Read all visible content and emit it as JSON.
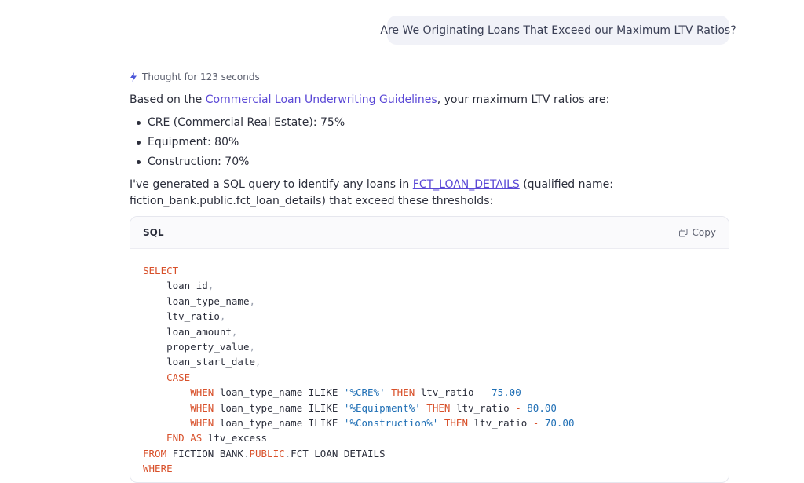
{
  "user_message": "Are We Originating Loans That Exceed our Maximum LTV Ratios?",
  "assistant": {
    "thought_label": "Thought for 123 seconds",
    "intro_prefix": "Based on the ",
    "intro_link": "Commercial Loan Underwriting Guidelines",
    "intro_suffix": ", your maximum LTV ratios are:",
    "bullets": [
      "CRE (Commercial Real Estate): 75%",
      "Equipment: 80%",
      "Construction: 70%"
    ],
    "query_line1_prefix": "I've generated a SQL query to identify any loans in ",
    "query_link": "FCT_LOAN_DETAILS",
    "query_line1_suffix": " (qualified name:",
    "query_line2": "fiction_bank.public.fct_loan_details) that exceed these thresholds:"
  },
  "code_block": {
    "language": "SQL",
    "copy_label": "Copy",
    "tokens": {
      "select": "SELECT",
      "col1": "loan_id",
      "col2": "loan_type_name",
      "col3": "ltv_ratio",
      "col4": "loan_amount",
      "col5": "property_value",
      "col6": "loan_start_date",
      "comma": ",",
      "case": "CASE",
      "when": "WHEN",
      "ilike": "ILIKE",
      "then": "THEN",
      "minus": "-",
      "pat1": "'%CRE%'",
      "pat2": "'%Equipment%'",
      "pat3": "'%Construction%'",
      "val1": "75.00",
      "val2": "80.00",
      "val3": "70.00",
      "end": "END",
      "as": "AS",
      "alias": "ltv_excess",
      "from": "FROM",
      "db": "FICTION_BANK",
      "dot": ".",
      "schema": "PUBLIC",
      "table": "FCT_LOAN_DETAILS",
      "where": "WHERE"
    }
  },
  "colors": {
    "keyword": "#d8502a",
    "string": "#1f6fb5",
    "link": "#5a48d6",
    "bubble_bg": "#f1f2f8"
  },
  "icons": {
    "thought": "lightning-icon",
    "copy": "copy-icon"
  }
}
